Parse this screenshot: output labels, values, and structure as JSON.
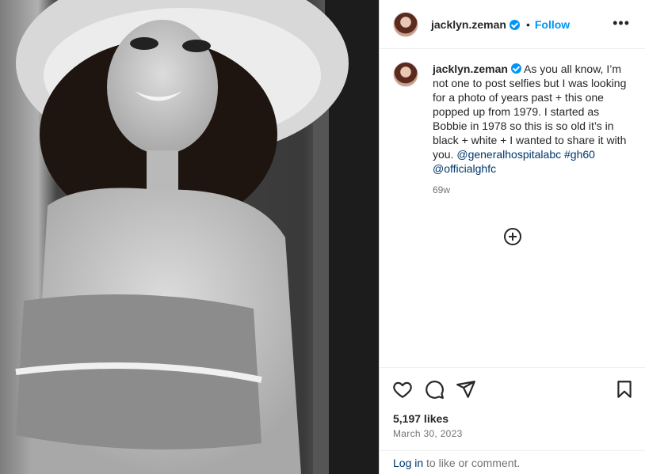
{
  "post": {
    "username": "jacklyn.zeman",
    "follow_label": "Follow",
    "separator": "•",
    "more_label": "•••"
  },
  "caption": {
    "username": "jacklyn.zeman",
    "text": " As you all know, I’m not one to post selfies but I was looking for a photo of years past + this one popped up from 1979. I started as Bobbie in 1978 so this is so old it’s in black + white + I wanted to share it with you. ",
    "mention1": "@generalhospitalabc",
    "hashtag": "#gh60",
    "mention2": "@officialghfc",
    "time_ago": "69w"
  },
  "stats": {
    "likes": "5,197 likes",
    "date": "March 30, 2023"
  },
  "footer": {
    "login_link": "Log in",
    "login_suffix": " to like or comment."
  },
  "icons": [
    "heart-icon",
    "comment-icon",
    "share-icon",
    "bookmark-icon",
    "plus-circle-icon",
    "verified-badge-icon",
    "more-options-icon"
  ],
  "colors": {
    "accent": "#0095f6",
    "link": "#00376b",
    "text": "#262626",
    "muted": "#737373",
    "border": "#dbdbdb"
  }
}
